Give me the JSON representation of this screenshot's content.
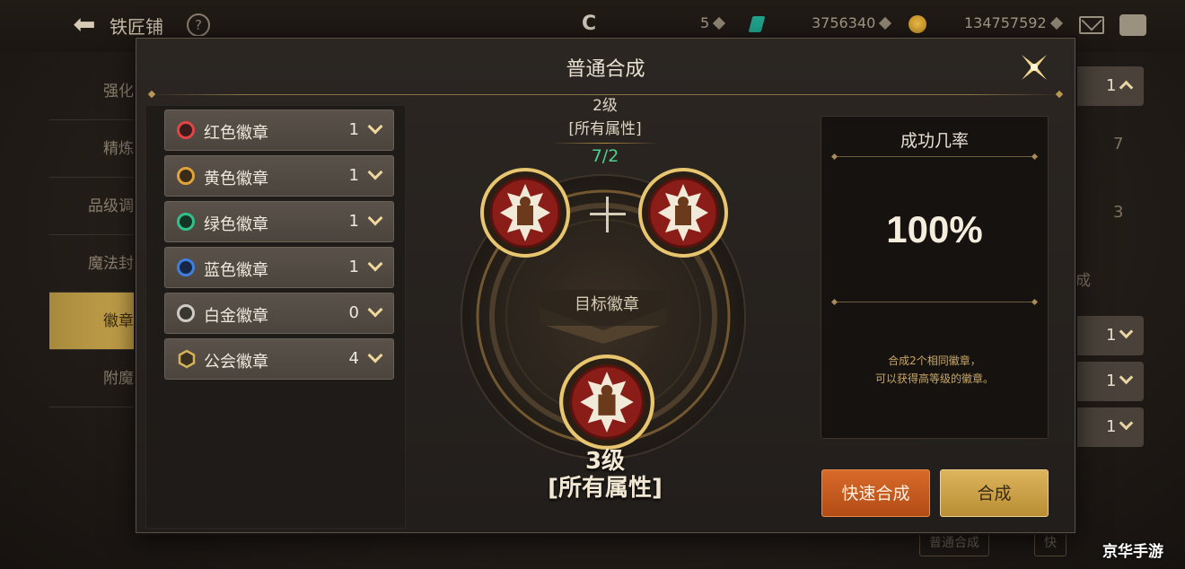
{
  "header": {
    "title": "铁匠铺",
    "help_icon": "?",
    "currency_1": "5",
    "currency_2": "3756340",
    "currency_3": "134757592"
  },
  "left_nav": {
    "items": [
      "强化",
      "精炼",
      "品级调",
      "魔法封",
      "徽章",
      "附魔"
    ],
    "active_index": 4
  },
  "bg_right": {
    "pills": [
      "1",
      "1",
      "1",
      "1"
    ],
    "numbers": [
      "7",
      "3"
    ],
    "text": "成",
    "bottom_buttons": [
      "普通合成",
      "快"
    ]
  },
  "modal": {
    "title": "普通合成",
    "badges": [
      {
        "name": "红色徽章",
        "count": "1",
        "color": "#e04444"
      },
      {
        "name": "黄色徽章",
        "count": "1",
        "color": "#e0a23a"
      },
      {
        "name": "绿色徽章",
        "count": "1",
        "color": "#2fc28b"
      },
      {
        "name": "蓝色徽章",
        "count": "1",
        "color": "#3f7ee0"
      },
      {
        "name": "白金徽章",
        "count": "0",
        "color": "#cfcac2"
      },
      {
        "name": "公会徽章",
        "count": "4",
        "color": "#d6b25a"
      }
    ],
    "source": {
      "level": "2级",
      "attr": "[所有属性]",
      "count": "7/2"
    },
    "target_label": "目标徽章",
    "result": {
      "level": "3级",
      "attr": "[所有属性]"
    },
    "success": {
      "title": "成功几率",
      "rate": "100%",
      "desc_line1": "合成2个相同徽章，",
      "desc_line2": "可以获得高等级的徽章。"
    },
    "buttons": {
      "quick": "快速合成",
      "merge": "合成"
    }
  },
  "watermark": "京华手游"
}
